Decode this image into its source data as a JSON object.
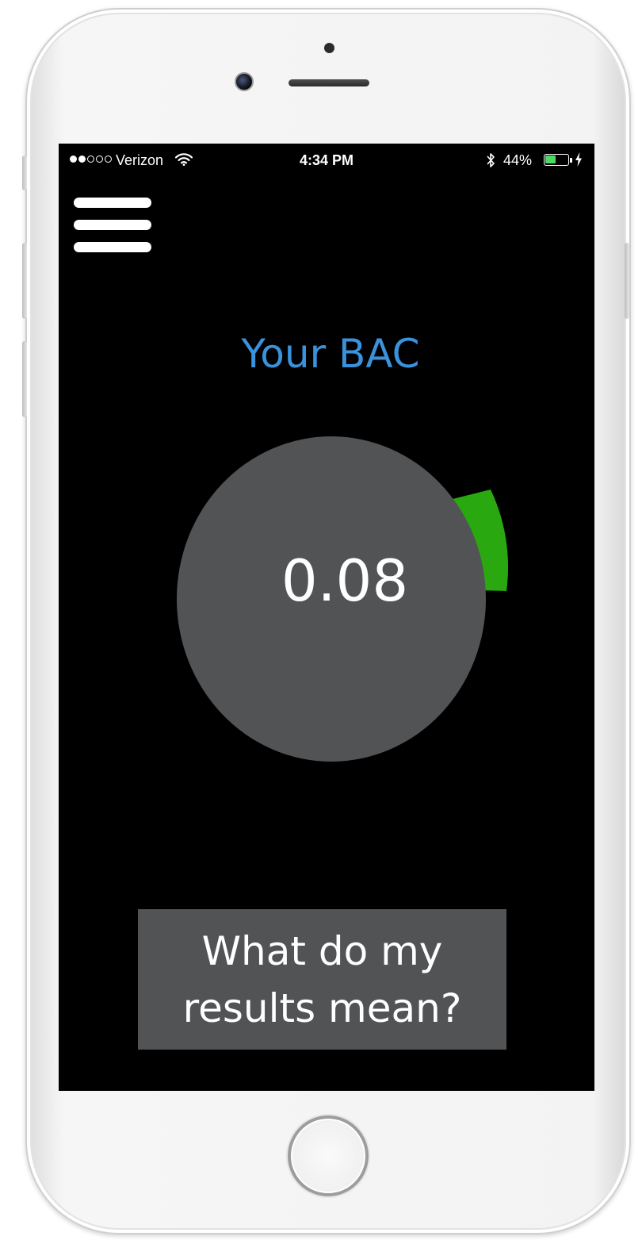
{
  "status_bar": {
    "signal_bars": {
      "filled": 2,
      "total": 5
    },
    "carrier": "Verizon",
    "wifi_icon": "wifi-icon",
    "time": "4:34 PM",
    "bluetooth_icon": "bluetooth-icon",
    "battery_percent_label": "44%",
    "battery_level": 0.44,
    "charging_icon": "charging-bolt-icon"
  },
  "header": {
    "menu_icon": "hamburger-menu-icon"
  },
  "main": {
    "title": "Your BAC",
    "bac_value": "0.08",
    "gauge": {
      "indicator_color": "#2aa810",
      "dial_color": "#525355"
    },
    "results_button": {
      "line1": "What do my",
      "line2": "results mean?"
    }
  },
  "colors": {
    "title": "#3a92dc",
    "screen_background": "#000000",
    "button_background": "#525355",
    "battery_fill": "#4cd964"
  }
}
